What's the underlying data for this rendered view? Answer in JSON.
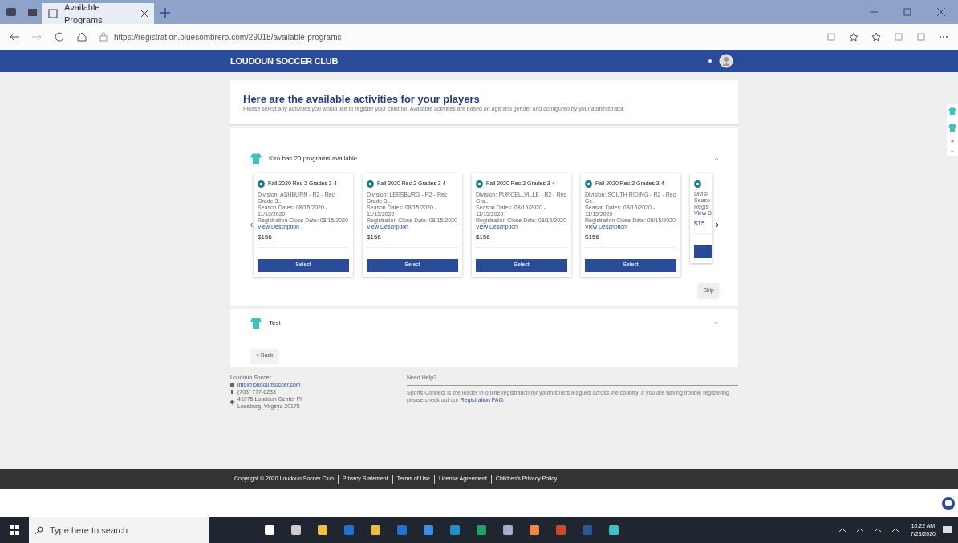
{
  "browser": {
    "tab_title": "Available Programs",
    "url": "https://registration.bluesombrero.com/29018/available-programs"
  },
  "header": {
    "title": "LOUDOUN SOCCER CLUB"
  },
  "intro": {
    "heading": "Here are the available activities for your players",
    "subtext": "Please select any activities you would like to register your child for. Available activities are based on age and gender and configured by your administrator."
  },
  "player_section": {
    "title": "Kiro has 20 programs available",
    "expanded": true,
    "cards": [
      {
        "title": "Fall 2020 Rec 2 Grades 3-4",
        "division": "Division: ASHBURN - R2 - Rec Grade 3...",
        "season": "Season Dates: 08/15/2020 - 11/15/2020",
        "close": "Registration Close Date: 08/15/2020",
        "link": "View Description",
        "price": "$156",
        "button": "Select"
      },
      {
        "title": "Fall 2020 Rec 2 Grades 3-4",
        "division": "Division: LEESBURG - R2 - Rec Grade 3...",
        "season": "Season Dates: 08/15/2020 - 11/15/2020",
        "close": "Registration Close Date: 08/15/2020",
        "link": "View Description",
        "price": "$156",
        "button": "Select"
      },
      {
        "title": "Fall 2020 Rec 2 Grades 3-4",
        "division": "Division: PURCELLVILLE - R2 - Rec Gra...",
        "season": "Season Dates: 08/15/2020 - 11/15/2020",
        "close": "Registration Close Date: 08/15/2020",
        "link": "View Description",
        "price": "$156",
        "button": "Select"
      },
      {
        "title": "Fall 2020 Rec 2 Grades 3-4",
        "division": "Division: SOUTH RIDING - R2 - Rec Gr...",
        "season": "Season Dates: 08/15/2020 - 11/15/2020",
        "close": "Registration Close Date: 08/15/2020",
        "link": "View Description",
        "price": "$156",
        "button": "Select"
      },
      {
        "division": "Divisi",
        "season": "Seaso",
        "close": "Regis",
        "link": "View D",
        "price": "$15"
      }
    ],
    "prev_arrow": "‹",
    "next_arrow": "›",
    "skip": "Skip"
  },
  "test_section": {
    "title": "Test",
    "expanded": false
  },
  "back": "< Back",
  "footer": {
    "org": "Loudoun Soccer",
    "email": "info@loudounsoccer.com",
    "phone": "(703) 777-6233",
    "address1": "41975 Loudoun Center Pl",
    "address2": "Leesburg, Virginia 20175",
    "help_title": "Need Help?",
    "help_text": "Sports Connect is the leader in online registration for youth sports leagues across the country. If you are having trouble registering please check out our",
    "help_link": "Registration FAQ."
  },
  "legal": [
    "Copyright © 2020 Loudoun Soccer Club",
    "Privacy Statement",
    "Terms of Use",
    "License Agreement",
    "Children's Privacy Policy"
  ],
  "taskbar": {
    "search_placeholder": "Type here to search",
    "time": "10:22 AM",
    "date": "7/23/2020"
  }
}
